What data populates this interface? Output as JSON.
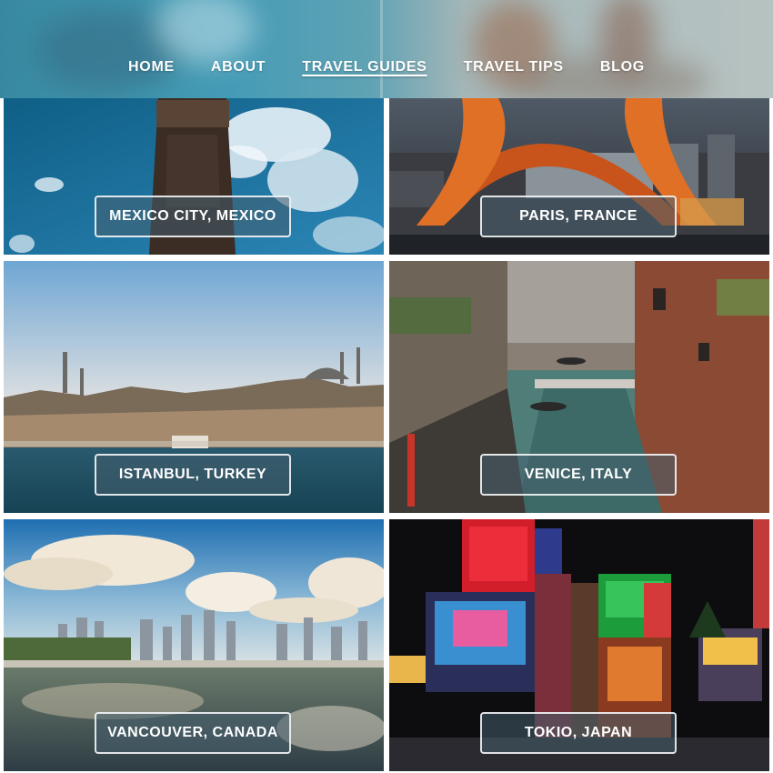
{
  "nav": {
    "items": [
      {
        "label": "HOME"
      },
      {
        "label": "ABOUT"
      },
      {
        "label": "TRAVEL GUIDES",
        "active": true
      },
      {
        "label": "TRAVEL TIPS"
      },
      {
        "label": "BLOG"
      }
    ]
  },
  "destinations": [
    {
      "label": "MEXICO CITY, MEXICO"
    },
    {
      "label": "PARIS, FRANCE"
    },
    {
      "label": "ISTANBUL, TURKEY"
    },
    {
      "label": "VENICE, ITALY"
    },
    {
      "label": "VANCOUVER, CANADA"
    },
    {
      "label": "TOKIO, JAPAN"
    }
  ],
  "colors": {
    "header_teal": "#1d86a6",
    "label_bg": "rgba(70,95,110,0.55)",
    "text": "#ffffff"
  }
}
